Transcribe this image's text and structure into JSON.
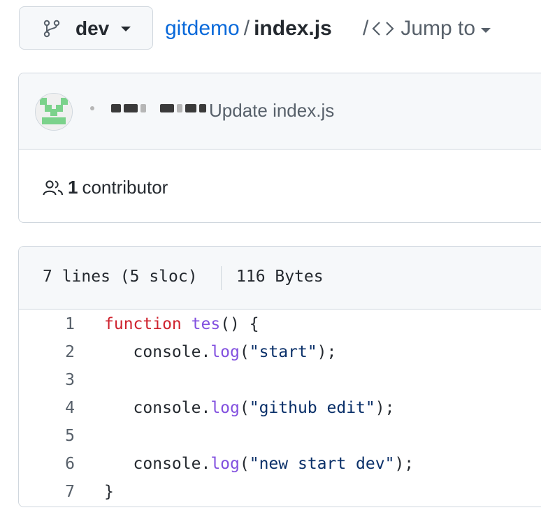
{
  "header": {
    "branch": "dev",
    "repo": "gitdemo",
    "separator": "/",
    "file": "index.js",
    "jump_slash": "/",
    "jump_label": "Jump to"
  },
  "commit": {
    "message": "Update index.js",
    "contributors_count": "1",
    "contributors_label": "contributor"
  },
  "file": {
    "lines": "7 lines (5 sloc)",
    "size": "116 Bytes"
  },
  "code": {
    "line_numbers": [
      "1",
      "2",
      "3",
      "4",
      "5",
      "6",
      "7"
    ],
    "l1": {
      "kw": "function",
      "sp": " ",
      "fn": "tes",
      "rest": "() {"
    },
    "l2": {
      "indent": "   ",
      "obj": "console.",
      "fn": "log",
      "open": "(",
      "str": "\"start\"",
      "close": ");"
    },
    "l4": {
      "indent": "   ",
      "obj": "console.",
      "fn": "log",
      "open": "(",
      "str": "\"github edit\"",
      "close": ");"
    },
    "l6": {
      "indent": "   ",
      "obj": "console.",
      "fn": "log",
      "open": "(",
      "str": "\"new start dev\"",
      "close": ");"
    },
    "l7": "}"
  },
  "colors": {
    "link": "#0969da",
    "keyword": "#cf222e",
    "function": "#8250df",
    "string": "#0a3069",
    "muted": "#57606a",
    "avatar_green": "#7bd28b"
  },
  "icons": {
    "branch": "git-branch-icon",
    "code": "code-icon",
    "people": "people-icon",
    "caret": "caret-down-icon"
  }
}
